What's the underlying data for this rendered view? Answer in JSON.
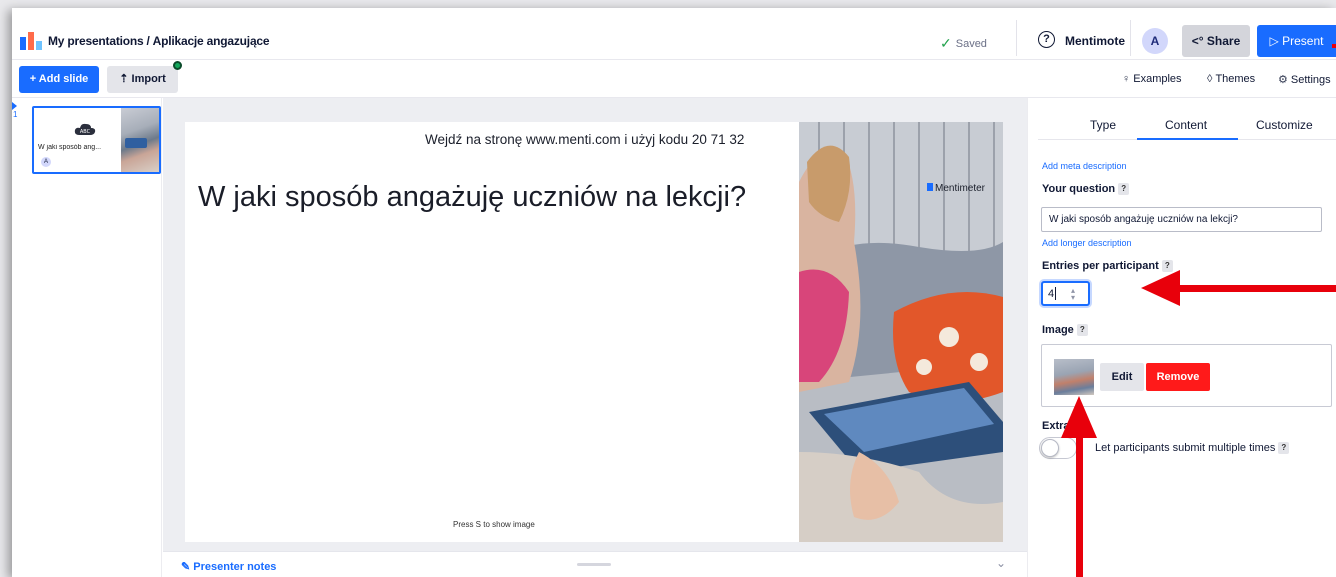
{
  "header": {
    "breadcrumb_root": "My presentations",
    "breadcrumb_sep": "/",
    "presentation_title": "Aplikacje angazujące",
    "saved_label": "Saved",
    "help_label": "?",
    "mentimote_label": "Mentimote",
    "avatar_initial": "A",
    "share_label": "Share",
    "present_label": "Present"
  },
  "toolbar": {
    "add_slide_label": "+ Add slide",
    "import_label": "Import",
    "examples_label": "Examples",
    "themes_label": "Themes",
    "settings_label": "Settings"
  },
  "slides": {
    "items": [
      {
        "number": "1",
        "label": "W jaki sposób ang...",
        "avatar": "A"
      }
    ]
  },
  "slide": {
    "instruction": "Wejdź na stronę www.menti.com i użyj kodu 20 71 32",
    "question": "W jaki sposób angażuję uczniów na lekcji?",
    "hint": "Press S to show image",
    "brand": "Mentimeter"
  },
  "presenter_notes": {
    "label": "Presenter notes"
  },
  "panel": {
    "tabs": [
      {
        "label": "Type",
        "active": false
      },
      {
        "label": "Content",
        "active": true
      },
      {
        "label": "Customize",
        "active": false
      }
    ],
    "add_meta_description": "Add meta description",
    "your_question_label": "Your question",
    "question_value": "W jaki sposób angażuję uczniów na lekcji?",
    "add_longer_description": "Add longer description",
    "entries_label": "Entries per participant",
    "entries_value": "4",
    "image_label": "Image",
    "edit_label": "Edit",
    "remove_label": "Remove",
    "extras_label": "Extras",
    "multiple_submit_label": "Let participants submit multiple times",
    "multiple_submit_on": false,
    "help_mark": "?"
  },
  "colors": {
    "accent": "#196cff",
    "danger": "#ff1a1a",
    "annotation": "#e8000b"
  }
}
